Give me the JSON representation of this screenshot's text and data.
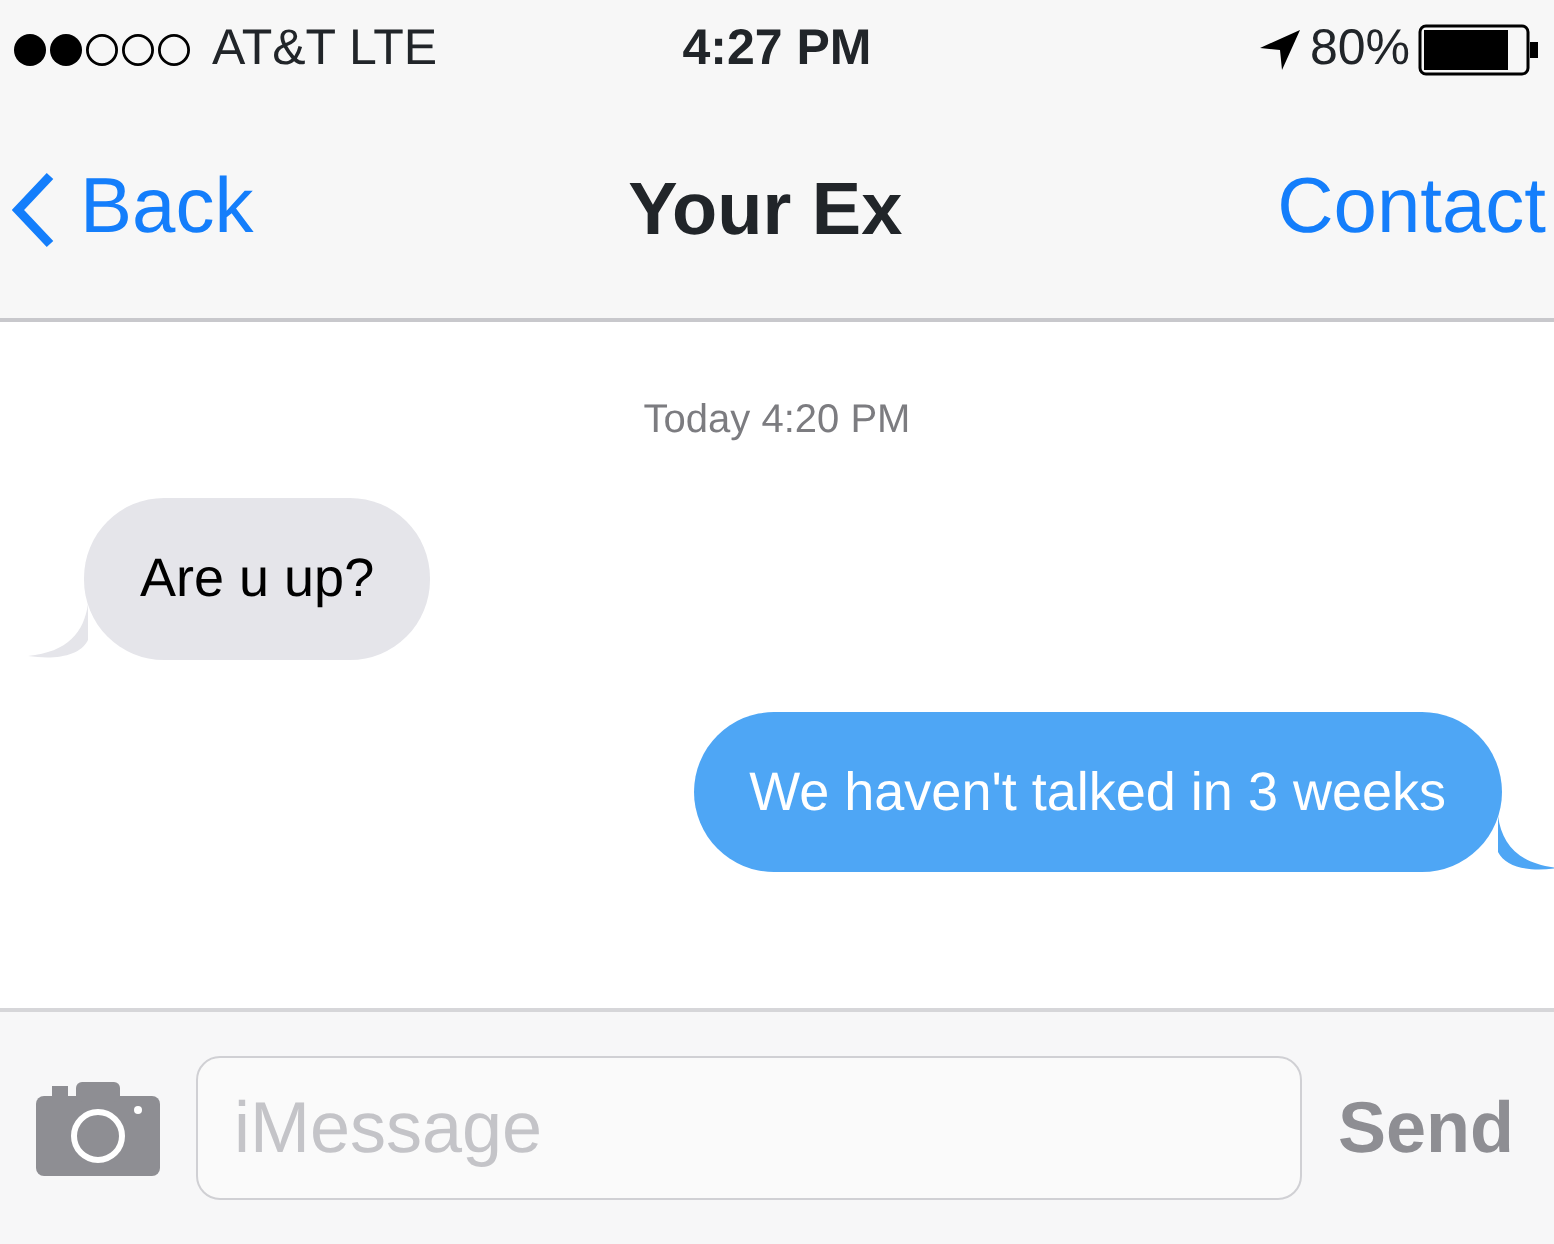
{
  "status_bar": {
    "carrier": "AT&T LTE",
    "time": "4:27 PM",
    "battery": "80%"
  },
  "nav_bar": {
    "back": "Back",
    "title": "Your Ex",
    "action": "Contact"
  },
  "timestamp": "Today 4:20 PM",
  "messages": [
    {
      "kind": "received",
      "text": "Are u up?"
    },
    {
      "kind": "sent",
      "text": "We haven't talked in 3 weeks"
    }
  ],
  "composer": {
    "placeholder": "iMessage",
    "send": "Send"
  }
}
